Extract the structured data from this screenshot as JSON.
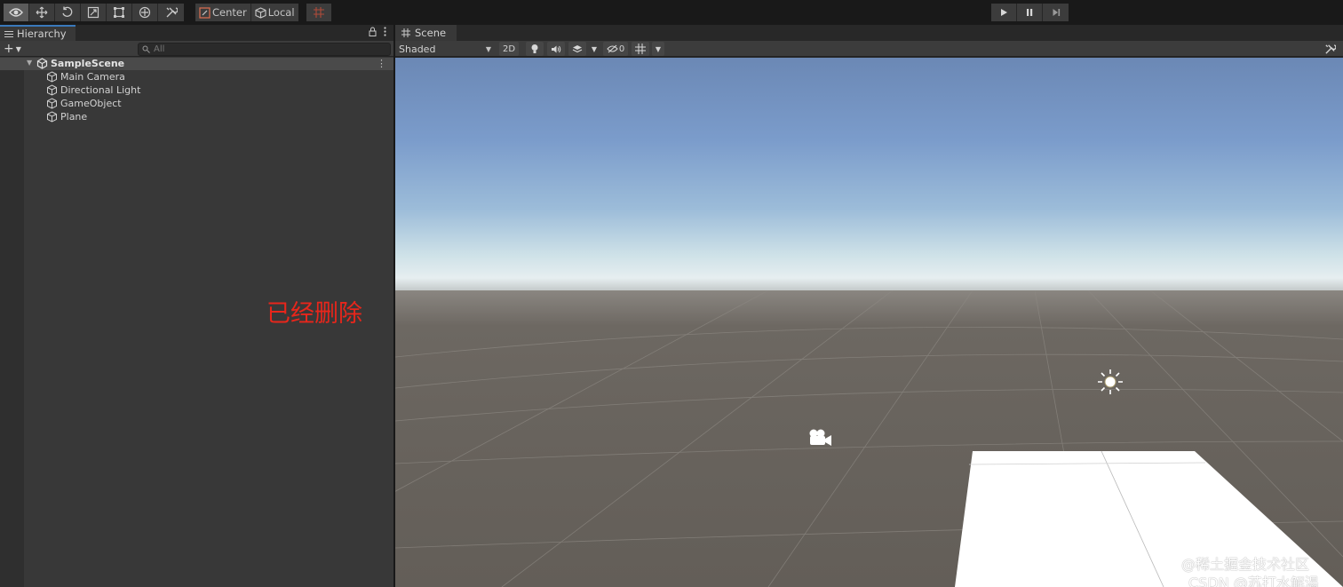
{
  "toolbar": {
    "tools": [
      {
        "name": "view-tool",
        "icon": "eye-icon",
        "active": true
      },
      {
        "name": "move-tool",
        "icon": "move-arrows-icon"
      },
      {
        "name": "rotate-tool",
        "icon": "rotate-icon"
      },
      {
        "name": "scale-tool",
        "icon": "scale-icon"
      },
      {
        "name": "rect-tool",
        "icon": "rect-icon"
      },
      {
        "name": "transform-tool",
        "icon": "transform-icon"
      },
      {
        "name": "custom-tool",
        "icon": "tools-icon"
      }
    ],
    "pivot_label": "Center",
    "pivot_rotation_label": "Local",
    "grid_snap_icon": "grid-snap-icon",
    "play_controls": [
      "play-icon",
      "pause-icon",
      "step-icon"
    ]
  },
  "hierarchy": {
    "tab_label": "Hierarchy",
    "search_placeholder": "All",
    "scene_name": "SampleScene",
    "items": [
      {
        "label": "Main Camera"
      },
      {
        "label": "Directional Light"
      },
      {
        "label": "GameObject"
      },
      {
        "label": "Plane"
      }
    ],
    "annotation": "已经删除",
    "annotation_color": "#e8261b"
  },
  "scene": {
    "tab_label": "Scene",
    "shading_mode": "Shaded",
    "mode_2d_label": "2D",
    "hidden_count": "0",
    "sky_color": "#7b9ccb",
    "ground_color": "#69645e"
  },
  "watermark": {
    "line1": "@稀土掘金技术社区",
    "line2": "CSDN @苏打水解渴"
  }
}
